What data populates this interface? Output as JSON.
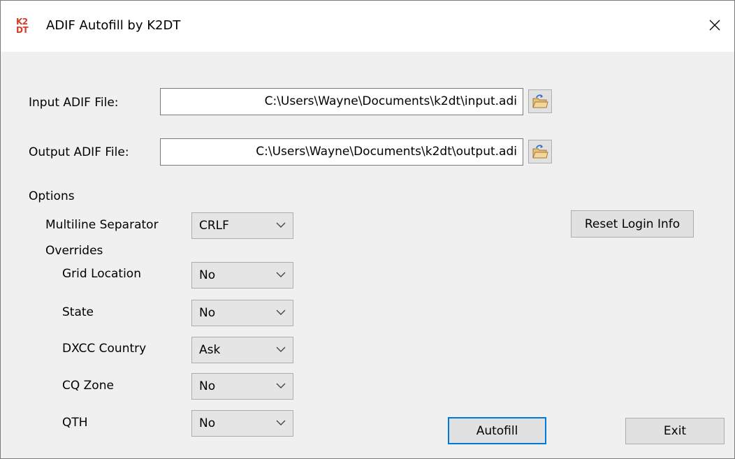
{
  "window": {
    "title": "ADIF Autofill by K2DT",
    "logo_text": [
      "K2",
      "DT"
    ],
    "close_glyph": "×"
  },
  "files": {
    "input_label": "Input ADIF File:",
    "input_value": "C:\\Users\\Wayne\\Documents\\k2dt\\input.adi",
    "output_label": "Output ADIF File:",
    "output_value": "C:\\Users\\Wayne\\Documents\\k2dt\\output.adi",
    "browse_icon": "folder-open-icon"
  },
  "options": {
    "heading": "Options",
    "multiline_label": "Multiline Separator",
    "multiline_value": "CRLF",
    "overrides_heading": "Overrides",
    "grid_label": "Grid Location",
    "grid_value": "No",
    "state_label": "State",
    "state_value": "No",
    "dxcc_label": "DXCC Country",
    "dxcc_value": "Ask",
    "cq_label": "CQ Zone",
    "cq_value": "No",
    "qth_label": "QTH",
    "qth_value": "No"
  },
  "buttons": {
    "reset_login": "Reset Login Info",
    "autofill": "Autofill",
    "exit": "Exit"
  },
  "colors": {
    "logo_red": "#d83a2c",
    "focus_blue": "#0078d7",
    "window_bg": "#f0f0f0"
  }
}
